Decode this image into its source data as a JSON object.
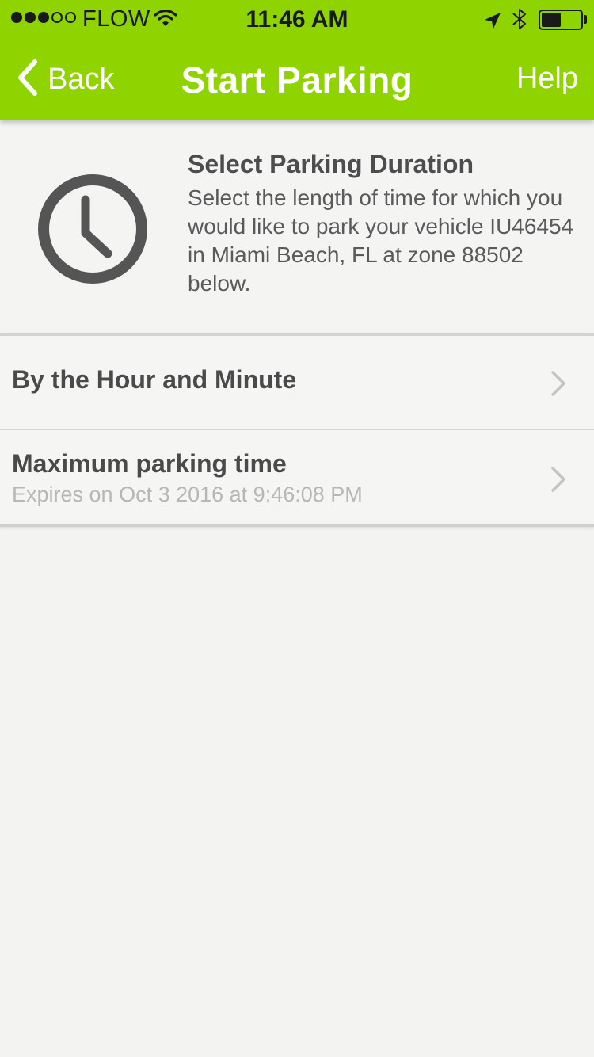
{
  "status_bar": {
    "signal_dots_filled": 3,
    "signal_dots_total": 5,
    "carrier": "FLOW",
    "time": "11:46 AM",
    "battery_level": 0.5,
    "icons": [
      "wifi-icon",
      "location-arrow-icon",
      "bluetooth-icon",
      "battery-icon"
    ]
  },
  "nav": {
    "back_label": "Back",
    "title": "Start Parking",
    "help_label": "Help"
  },
  "info": {
    "icon": "clock-icon",
    "title": "Select Parking Duration",
    "body": "Select the length of time for which you would like to park your vehicle IU46454 in Miami Beach, FL at zone 88502 below."
  },
  "options": [
    {
      "title": "By the Hour and Minute",
      "subtitle": ""
    },
    {
      "title": "Maximum parking time",
      "subtitle": "Expires on Oct 3 2016 at 9:46:08 PM"
    }
  ],
  "colors": {
    "accent": "#8fd400",
    "background": "#f3f3f2",
    "text": "#4a4a4a",
    "subtext": "#b7b7b7",
    "icon": "#555555"
  }
}
